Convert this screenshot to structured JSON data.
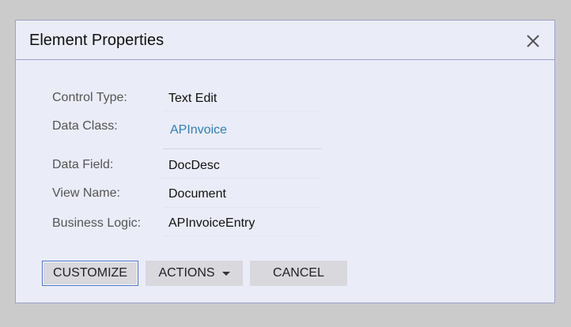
{
  "dialog": {
    "title": "Element Properties",
    "close_icon": "close-icon"
  },
  "properties": [
    {
      "label": "Control Type:",
      "value": "Text Edit",
      "is_link": false
    },
    {
      "label": "Data Class:",
      "value": "APInvoice",
      "is_link": true
    },
    {
      "label": "Data Field:",
      "value": "DocDesc",
      "is_link": false
    },
    {
      "label": "View Name:",
      "value": "Document",
      "is_link": false
    },
    {
      "label": "Business Logic:",
      "value": "APInvoiceEntry",
      "is_link": false
    }
  ],
  "buttons": {
    "customize": "CUSTOMIZE",
    "actions": "ACTIONS",
    "cancel": "CANCEL"
  },
  "colors": {
    "page_background": "#cbcbcb",
    "dialog_background": "#eaecf8",
    "dialog_border": "#9aa3c9",
    "link": "#2d7fb8",
    "button_background": "#d8d8dd",
    "focus_border": "#4a74c9"
  }
}
